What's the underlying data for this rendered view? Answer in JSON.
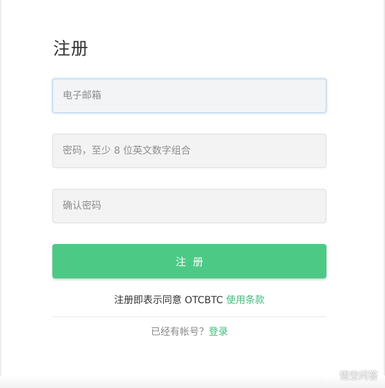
{
  "form": {
    "title": "注册",
    "email_placeholder": "电子邮箱",
    "password_placeholder": "密码，至少 8 位英文数字组合",
    "confirm_placeholder": "确认密码",
    "submit_label": "注册"
  },
  "agreement": {
    "text": "注册即表示同意 OTCBTC ",
    "link_label": "使用条款"
  },
  "login": {
    "text": "已经有帐号？",
    "link_label": "登录"
  },
  "watermark": {
    "text": "悟空问答",
    "icon": "chat-bubble-icon"
  },
  "colors": {
    "accent": "#4dc986",
    "link": "#3ebd7b"
  }
}
